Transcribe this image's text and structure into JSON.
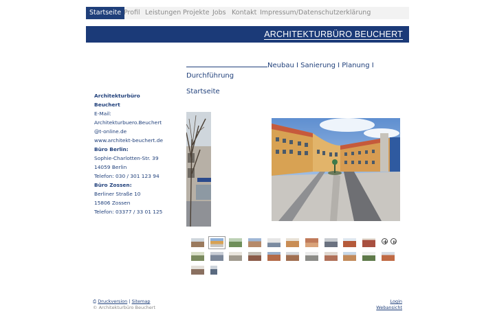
{
  "nav": {
    "items": [
      "Startseite",
      "Profil",
      "Leistungen",
      "Projekte",
      "Jobs",
      "Kontakt",
      "Impressum/Datenschutzerklärung"
    ],
    "active_index": 0
  },
  "banner": {
    "title": "ARCHITEKTURBÜRO BEUCHERT"
  },
  "tagline": {
    "text": "Neubau I Sanierung I Planung I",
    "text2": "Durchführung"
  },
  "page_heading": "Startseite",
  "sidebar": {
    "company": "Architekturbüro",
    "company2": "Beuchert",
    "email_label": "E-Mail:",
    "email1": "Architekturbuero.Beuchert",
    "email2": "@t-online.de",
    "website": "www.architekt-beuchert.de",
    "office1_title": "Büro Berlin:",
    "office1_street": "Sophie-Charlotten-Str. 39",
    "office1_city": "14059 Berlin",
    "office1_phone": "Telefon: 030 / 301 123 94",
    "office2_title": "Büro Zossen:",
    "office2_street": "Berliner Straße 10",
    "office2_city": "15806 Zossen",
    "office2_phone": "Telefon: 03377 / 33 01 125"
  },
  "gallery": {
    "thumb_count": 23,
    "active_thumb": 1,
    "controls": [
      "zoom-icon",
      "pause-icon"
    ]
  },
  "footer": {
    "print_label": "Druckversion",
    "sitemap_label": "Sitemap",
    "copyright": "© Architekturbüro Beuchert",
    "login_label": "Login",
    "webansicht_label": "Webansicht"
  }
}
